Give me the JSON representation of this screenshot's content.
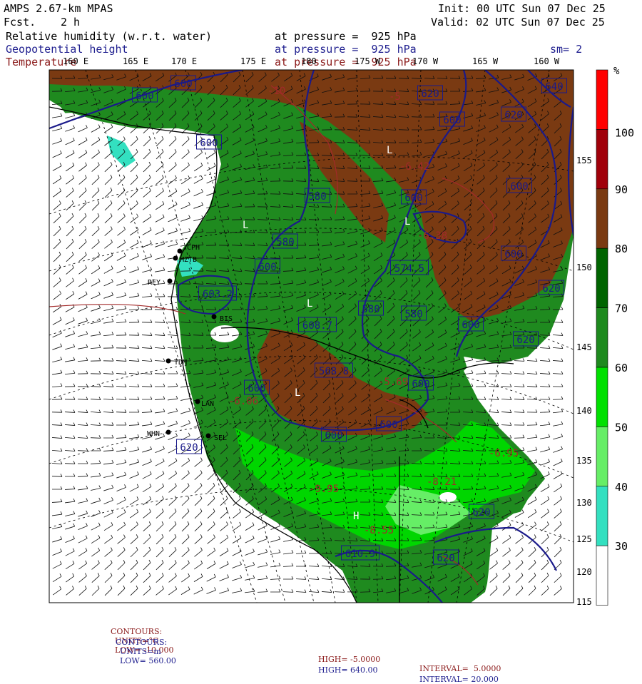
{
  "header": {
    "model": "AMPS 2.67-km MPAS",
    "fcst_label": "Fcst.",
    "fcst_value": "2 h",
    "init": "Init: 00 UTC Sun 07 Dec 25",
    "valid": "Valid: 02 UTC Sun 07 Dec 25",
    "fields": [
      {
        "name": "Relative humidity (w.r.t. water)",
        "level": "at pressure =  925 hPa",
        "color": "#000000"
      },
      {
        "name": "Geopotential height",
        "level": "at pressure =  925 hPa",
        "color": "#1f1f8f"
      },
      {
        "name": "Temperature",
        "level": "at pressure =  925 hPa",
        "color": "#8b1a1a"
      }
    ],
    "smoothing": "sm= 2"
  },
  "top_lon_labels": [
    "160 E",
    "165 E",
    "170 E",
    "175 E",
    "180",
    "175 W",
    "170 W",
    "165 W",
    "160 W"
  ],
  "right_lat_labels": [
    "155",
    "150",
    "145",
    "140",
    "135",
    "130",
    "125",
    "120",
    "115"
  ],
  "colorbar": {
    "unit": "%",
    "labels": [
      "100",
      "90",
      "80",
      "70",
      "60",
      "50",
      "40",
      "30"
    ],
    "colors": [
      "#ff0000",
      "#a0000a",
      "#7a3a12",
      "#006400",
      "#1e8a1e",
      "#00e000",
      "#66ee66",
      "#33e0c0",
      "#ffffff"
    ],
    "note": "colors top to bottom"
  },
  "stations": [
    "CPH",
    "MZTB",
    "REY",
    "BIS",
    "TDM",
    "LAN",
    "WHN",
    "SEL"
  ],
  "height_labels": [
    "600",
    "600",
    "620",
    "640",
    "620",
    "600",
    "600",
    "580",
    "600",
    "600",
    "580",
    "600",
    "603.2",
    "574.5",
    "580",
    "580",
    "600",
    "620",
    "600",
    "568.8",
    "600",
    "600",
    "600",
    "620",
    "620",
    "620",
    "610.9",
    "608.7",
    "620",
    "600"
  ],
  "temp_labels": [
    "-5",
    "-10",
    "-6.42",
    "-6.38",
    "-9.95",
    "-8.55",
    "-8.21",
    "-6.95",
    "-5.69",
    "-6.06"
  ],
  "pressure_centers": [
    "L",
    "L",
    "L",
    "L",
    "L",
    "H"
  ],
  "footer": {
    "temp": {
      "label": "CONTOURS:",
      "units": "UNITS=°C",
      "low": "LOW= -10.000",
      "high": "HIGH= -5.0000",
      "interval": "INTERVAL=  5.0000"
    },
    "height": {
      "label": "CONTOURS:",
      "units": "UNITS=m",
      "low": "LOW= 560.00",
      "high": "HIGH= 640.00",
      "interval": "INTERVAL= 20.000"
    }
  }
}
